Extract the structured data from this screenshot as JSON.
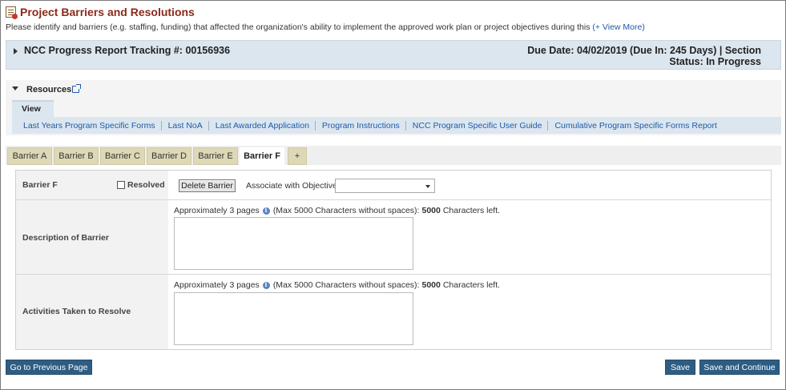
{
  "header": {
    "title": "Project Barriers and Resolutions",
    "intro": "Please identify and barriers (e.g. staffing, funding) that affected the organization's ability to implement the approved work plan or project objectives during this",
    "view_more": "(+ View More)"
  },
  "tracking": {
    "label": "NCC Progress Report Tracking #: 00156936",
    "due_line1": "Due Date: 04/02/2019 (Due In: 245 Days) | Section",
    "due_line2": "Status: In Progress"
  },
  "resources": {
    "label": "Resources",
    "view_tab": "View",
    "links": [
      "Last Years Program Specific Forms",
      "Last NoA",
      "Last Awarded Application",
      "Program Instructions",
      "NCC Program Specific User Guide",
      "Cumulative Program Specific Forms Report"
    ]
  },
  "tabs": [
    "Barrier A",
    "Barrier B",
    "Barrier C",
    "Barrier D",
    "Barrier E",
    "Barrier F",
    "+"
  ],
  "active_tab": "Barrier F",
  "form": {
    "barrier_name": "Barrier F",
    "resolved_label": "Resolved",
    "resolved_checked": false,
    "delete_button": "Delete Barrier",
    "associate_label": "Associate with Objectives",
    "associate_value": "",
    "description_label": "Description of Barrier",
    "activities_label": "Activities Taken to Resolve",
    "hint_prefix": "Approximately 3 pages",
    "hint_middle": "(Max 5000 Characters without spaces):",
    "chars_left": "5000",
    "hint_suffix": "Characters left.",
    "description_value": "",
    "activities_value": ""
  },
  "footer": {
    "previous": "Go to Previous Page",
    "save": "Save",
    "save_continue": "Save and Continue"
  },
  "colors": {
    "title": "#8b2a1a",
    "link": "#1f5aa6",
    "tab_inactive": "#ddd8b6",
    "button_primary": "#2e5d83",
    "bar_background": "#dce6ef"
  }
}
